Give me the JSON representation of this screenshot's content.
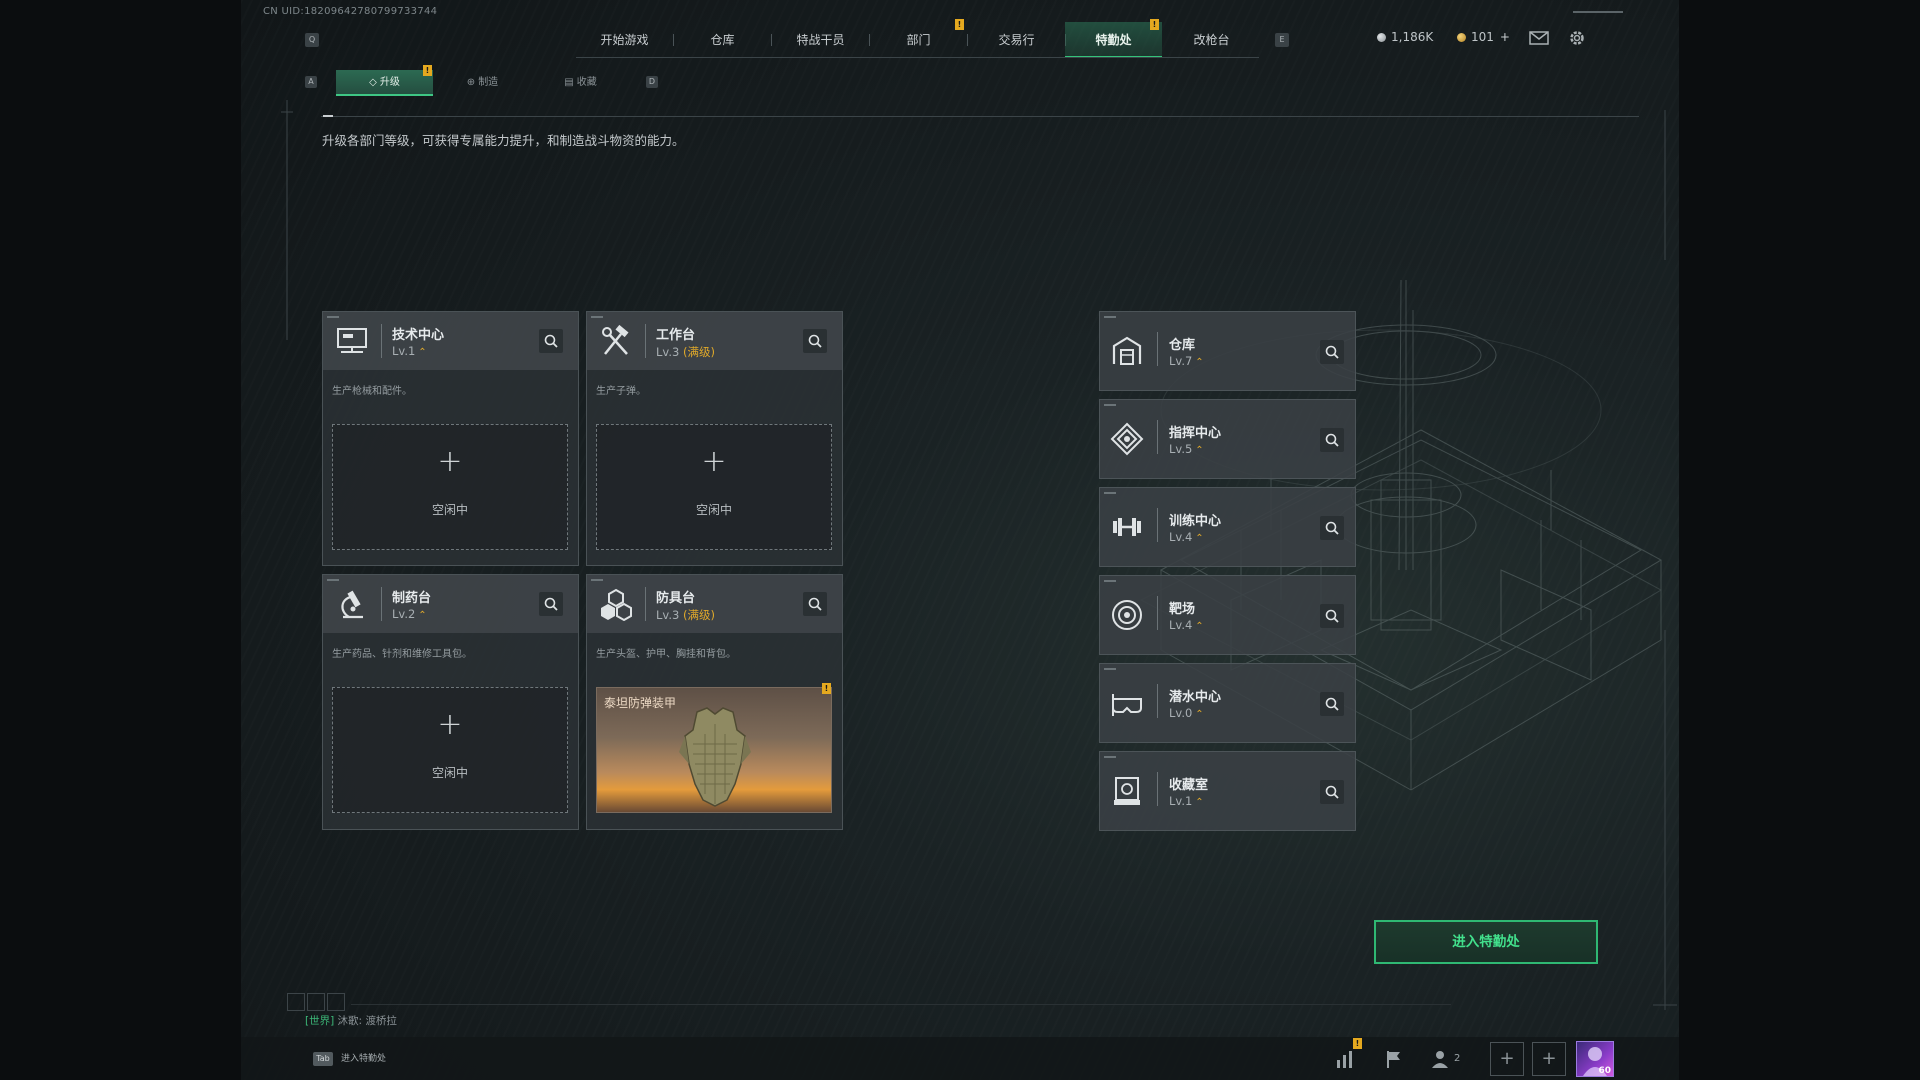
{
  "uid": "CN UID:18209642780799733744",
  "nav": {
    "left_key": "Q",
    "right_key": "E",
    "tabs": [
      {
        "label": "开始游戏",
        "active": false
      },
      {
        "label": "仓库",
        "active": false
      },
      {
        "label": "特战干员",
        "active": false
      },
      {
        "label": "部门",
        "active": false,
        "alert": "!"
      },
      {
        "label": "交易行",
        "active": false
      },
      {
        "label": "特勤处",
        "active": true,
        "alert": "!"
      },
      {
        "label": "改枪台",
        "active": false
      }
    ]
  },
  "currency": {
    "primary": "1,186K",
    "secondary": "101"
  },
  "subnav": {
    "left_key": "A",
    "right_key": "D",
    "tabs": [
      {
        "label": "升级",
        "active": true,
        "alert": "!"
      },
      {
        "label": "制造",
        "active": false
      },
      {
        "label": "收藏",
        "active": false
      }
    ]
  },
  "description": "升级各部门等级，可获得专属能力提升，和制造战斗物资的能力。",
  "production": [
    {
      "title": "技术中心",
      "level": "Lv.1",
      "max": "",
      "desc": "生产枪械和配件。",
      "slot": "空闲中",
      "icon": "monitor-icon"
    },
    {
      "title": "工作台",
      "level": "Lv.3",
      "max": "(满级)",
      "desc": "生产子弹。",
      "slot": "空闲中",
      "icon": "hammer-wrench-icon"
    },
    {
      "title": "制药台",
      "level": "Lv.2",
      "max": "",
      "desc": "生产药品、针剂和维修工具包。",
      "slot": "空闲中",
      "icon": "microscope-icon"
    },
    {
      "title": "防具台",
      "level": "Lv.3",
      "max": "(满级)",
      "desc": "生产头盔、护甲、胸挂和背包。",
      "slot_item": "泰坦防弹装甲",
      "slot_alert": "!",
      "icon": "cubes-icon"
    }
  ],
  "facilities": [
    {
      "title": "仓库",
      "level": "Lv.7",
      "icon": "warehouse-icon"
    },
    {
      "title": "指挥中心",
      "level": "Lv.5",
      "icon": "command-icon"
    },
    {
      "title": "训练中心",
      "level": "Lv.4",
      "icon": "dumbbell-icon"
    },
    {
      "title": "靶场",
      "level": "Lv.4",
      "icon": "target-icon"
    },
    {
      "title": "潜水中心",
      "level": "Lv.0",
      "icon": "diving-mask-icon"
    },
    {
      "title": "收藏室",
      "level": "Lv.1",
      "icon": "display-case-icon"
    }
  ],
  "enter_button": "进入特勤处",
  "chat": {
    "channel": "[世界]",
    "user": "沐歌:",
    "message": "渡桥拉"
  },
  "footer": {
    "tab_key": "Tab",
    "tab_label": "进入特勤处",
    "friends": "2",
    "avatar_level": "60",
    "alert": "!"
  },
  "colors": {
    "accent_green": "#34c27a",
    "warning": "#e5a91f",
    "level_up": "#e0a92a"
  }
}
